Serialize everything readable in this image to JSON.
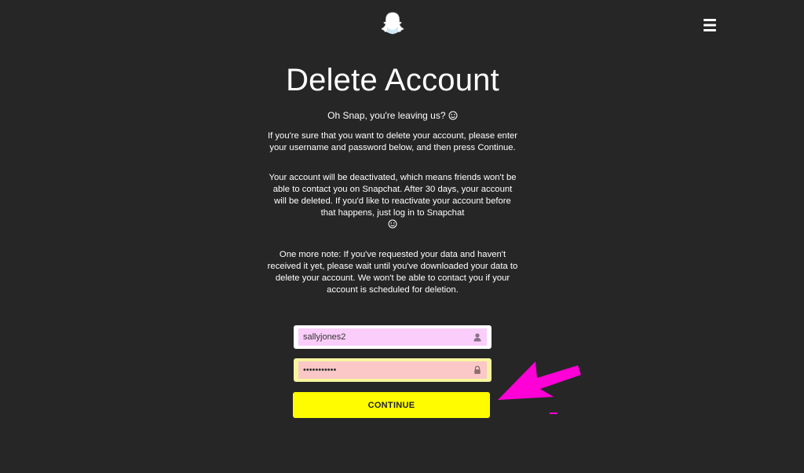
{
  "header": {
    "logo_icon": "snapchat-ghost-icon",
    "menu_icon": "hamburger-menu-icon"
  },
  "main": {
    "title": "Delete Account",
    "subtitle": "Oh Snap, you're leaving us?",
    "paragraph_1": "If you're sure that you want to delete your account, please enter your username and password below, and then press Continue.",
    "paragraph_2": "Your account will be deactivated, which means friends won't be able to contact you on Snapchat. After 30 days, your account will be deleted. If you'd like to reactivate your account before that happens, just log in to Snapchat",
    "paragraph_3": "One more note: If you've requested your data and haven't received it yet, please wait until you've downloaded your data to delete your account. We won't be able to contact you if your account is scheduled for deletion.",
    "emoji_icon": "face-emoji-icon"
  },
  "form": {
    "username_value": "sallyjones2",
    "username_icon": "user-icon",
    "password_value": "•••••••••••",
    "password_icon": "lock-icon",
    "continue_label": "CONTINUE"
  },
  "annotation": {
    "arrow_icon": "pointer-arrow-icon",
    "arrow_color": "#ff00d6"
  },
  "colors": {
    "background": "#262626",
    "button": "#fffc00"
  }
}
